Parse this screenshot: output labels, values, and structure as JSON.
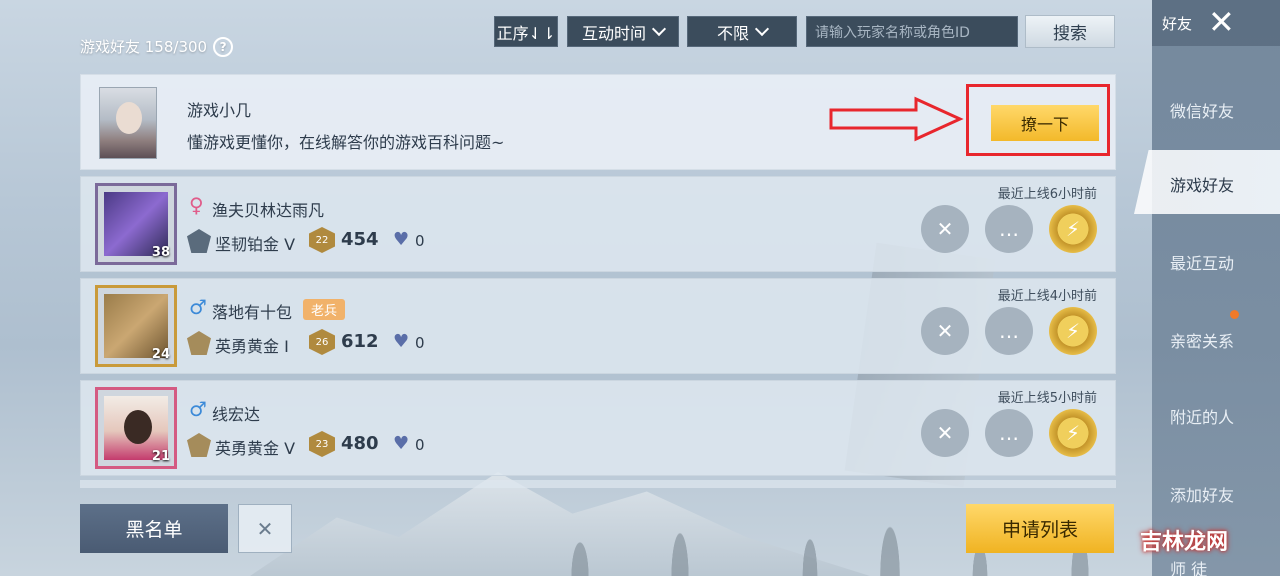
{
  "header": {
    "title": "游戏好友 158/300",
    "sort_label": "正序⇃⇂",
    "time_label": "互动时间",
    "range_label": "不限",
    "search_placeholder": "请输入玩家名称或角色ID",
    "search_button": "搜索"
  },
  "pinned": {
    "name": "游戏小几",
    "description": "懂游戏更懂你，在线解答你的游戏百科问题~",
    "poke_button": "撩一下"
  },
  "friends": [
    {
      "gender": "female",
      "gender_symbol": "♀",
      "name": "渔夫贝林达雨凡",
      "level": "38",
      "rank": "坚韧铂金 V",
      "rank_level": "22",
      "points": "454",
      "hearts": "0",
      "last_online": "最近上线6小时前",
      "tag": ""
    },
    {
      "gender": "male",
      "gender_symbol": "♂",
      "name": "落地有十包",
      "level": "24",
      "rank": "英勇黄金 I",
      "rank_level": "26",
      "points": "612",
      "hearts": "0",
      "last_online": "最近上线4小时前",
      "tag": "老兵"
    },
    {
      "gender": "male",
      "gender_symbol": "♂",
      "name": "线宏达",
      "level": "21",
      "rank": "英勇黄金 V",
      "rank_level": "23",
      "points": "480",
      "hearts": "0",
      "last_online": "最近上线5小时前",
      "tag": ""
    }
  ],
  "bottom": {
    "blacklist": "黑名单",
    "apply_list": "申请列表"
  },
  "sidebar": {
    "header": "好友",
    "items": [
      "微信好友",
      "游戏好友",
      "最近互动",
      "亲密关系",
      "附近的人",
      "添加好友",
      "师 徒"
    ],
    "active_index": 1
  },
  "watermark": "吉林龙网",
  "colors": {
    "accent_gold": "#f3b92a",
    "highlight_red": "#e8262d",
    "notify_orange": "#f07a2a"
  },
  "icons": [
    "help-icon",
    "chevron-down-icon",
    "close-icon",
    "remove-friend-icon",
    "chat-icon",
    "gift-icon",
    "heart-icon",
    "arrow-icon"
  ]
}
